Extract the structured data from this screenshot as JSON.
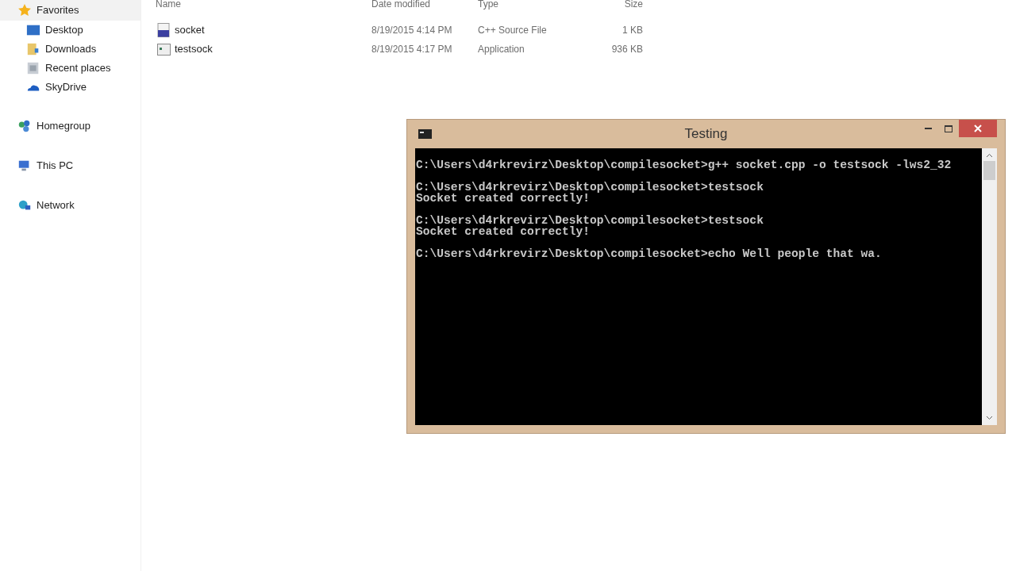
{
  "sidebar": {
    "groups": [
      {
        "label": "Favorites",
        "kind": "star",
        "selected": true,
        "children": [
          {
            "label": "Desktop",
            "kind": "desktop"
          },
          {
            "label": "Downloads",
            "kind": "downloads"
          },
          {
            "label": "Recent places",
            "kind": "recent"
          },
          {
            "label": "SkyDrive",
            "kind": "cloud"
          }
        ]
      },
      {
        "label": "Homegroup",
        "kind": "homegroup",
        "selected": false
      },
      {
        "label": "This PC",
        "kind": "pc",
        "selected": false
      },
      {
        "label": "Network",
        "kind": "network",
        "selected": false
      }
    ]
  },
  "files": {
    "columns": [
      "Name",
      "Date modified",
      "Type",
      "Size"
    ],
    "rows": [
      {
        "name": "socket",
        "kind": "source",
        "date": "8/19/2015 4:14 PM",
        "type": "C++ Source File",
        "size": "1 KB"
      },
      {
        "name": "testsock",
        "kind": "app",
        "date": "8/19/2015 4:17 PM",
        "type": "Application",
        "size": "936 KB"
      }
    ]
  },
  "console": {
    "title": "Testing",
    "blocks": [
      [
        "C:\\Users\\d4rkrevirz\\Desktop\\compilesocket>g++ socket.cpp -o testsock -lws2_32"
      ],
      [
        "C:\\Users\\d4rkrevirz\\Desktop\\compilesocket>testsock",
        "Socket created correctly!"
      ],
      [
        "C:\\Users\\d4rkrevirz\\Desktop\\compilesocket>testsock",
        "Socket created correctly!"
      ],
      [
        "C:\\Users\\d4rkrevirz\\Desktop\\compilesocket>echo Well people that wa."
      ]
    ]
  }
}
